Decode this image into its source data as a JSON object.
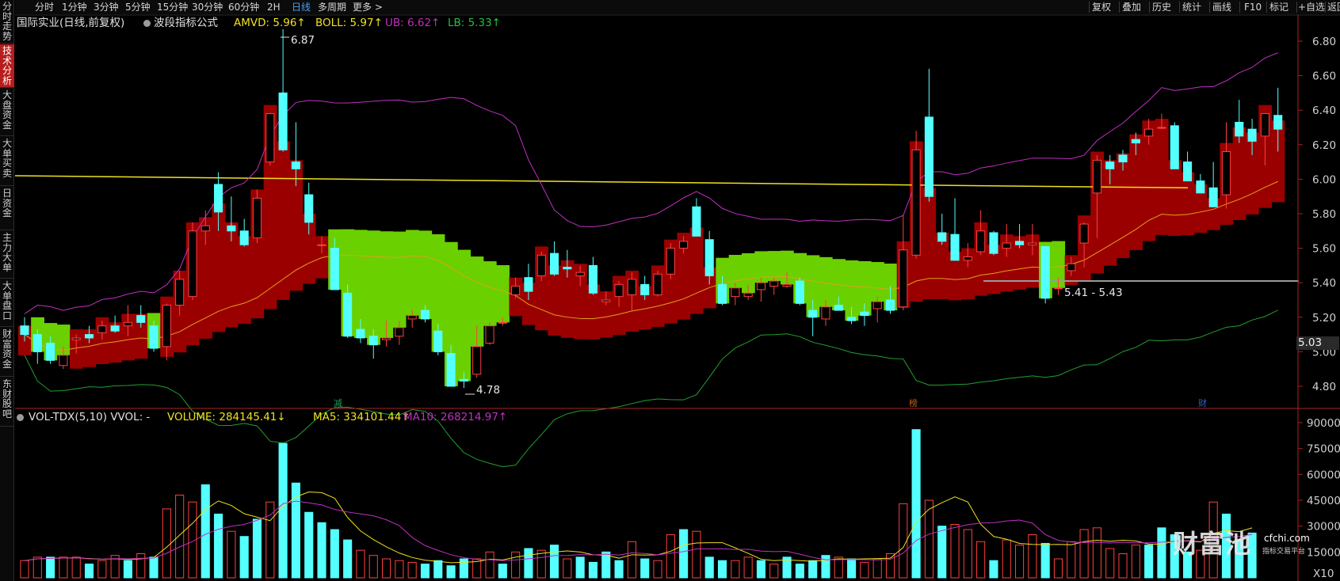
{
  "sidebar": {
    "tabs": [
      {
        "label": "分时走势",
        "active": false
      },
      {
        "label": "技术分析",
        "active": true
      },
      {
        "label": "大盘资金",
        "active": false
      },
      {
        "label": "大单买卖",
        "active": false
      },
      {
        "label": "日资金",
        "active": false
      },
      {
        "label": "主力大单",
        "active": false
      },
      {
        "label": "大单盘口",
        "active": false
      },
      {
        "label": "财富资金",
        "active": false
      },
      {
        "label": "东财股吧",
        "active": false
      }
    ]
  },
  "toolbar": {
    "periods": [
      "分时",
      "1分钟",
      "3分钟",
      "5分钟",
      "15分钟",
      "30分钟",
      "60分钟",
      "2H",
      "日线",
      "多周期",
      "更多 >"
    ],
    "active_period": "日线",
    "right_items": [
      "复权",
      "叠加",
      "历史",
      "统计",
      "画线",
      "F10",
      "标记",
      "+自选",
      "返回"
    ]
  },
  "legend": {
    "title": "国际实业(日线,前复权)",
    "formula": "波段指标公式",
    "amvd": "AMVD: 5.96↑",
    "boll": "BOLL: 5.97↑",
    "ub": "UB: 6.62↑",
    "lb": "LB: 5.33↑"
  },
  "volume_legend": {
    "title": "VOL-TDX(5,10) VVOL: -",
    "volume": "VOLUME: 284145.41↓",
    "ma5": "MA5: 334101.44↑",
    "ma10": "MA10: 268214.97↑"
  },
  "price_axis": {
    "labels": [
      "6.80",
      "6.60",
      "6.40",
      "6.20",
      "6.00",
      "5.80",
      "5.60",
      "5.40",
      "5.20",
      "5.00",
      "4.80"
    ],
    "current": "5.03"
  },
  "volume_axis": {
    "labels": [
      "90000",
      "75000",
      "60000",
      "45000",
      "30000",
      "15000"
    ],
    "unit": "X10"
  },
  "annotations": {
    "high": "6.87",
    "low": "4.78",
    "range": "5.41 - 5.43"
  },
  "events": [
    {
      "label": "减",
      "color": "#1fa05a"
    },
    {
      "label": "榜",
      "color": "#c06020"
    },
    {
      "label": "财",
      "color": "#3060c0"
    }
  ],
  "colors": {
    "up": "#ff4040",
    "down": "#54ffff",
    "ma_yellow": "#f0e020",
    "ub": "#c030c0",
    "lb": "#20a030",
    "fill_red": "#9b0000",
    "fill_green": "#6ad000",
    "axis": "#aa2222"
  },
  "watermark": {
    "brand": "财富池",
    "site": "cfchi.com",
    "sub": "指标交易平台"
  },
  "chart_data": {
    "type": "candlestick",
    "price_ylim": [
      4.7,
      6.9
    ],
    "volume_ylim": [
      0,
      90000
    ],
    "candles": [
      [
        5.15,
        5.2,
        5.06,
        5.1
      ],
      [
        5.1,
        5.13,
        4.93,
        5.0
      ],
      [
        5.05,
        5.09,
        4.93,
        4.95
      ],
      [
        4.92,
        5.03,
        4.9,
        4.98
      ],
      [
        5.07,
        5.1,
        4.99,
        5.08
      ],
      [
        5.1,
        5.15,
        5.05,
        5.08
      ],
      [
        5.11,
        5.18,
        5.07,
        5.15
      ],
      [
        5.15,
        5.21,
        5.11,
        5.12
      ],
      [
        5.15,
        5.27,
        5.09,
        5.17
      ],
      [
        5.21,
        5.27,
        5.14,
        5.17
      ],
      [
        5.15,
        5.18,
        5.0,
        5.02
      ],
      [
        5.03,
        5.28,
        4.95,
        5.27
      ],
      [
        5.27,
        5.47,
        5.21,
        5.42
      ],
      [
        5.32,
        5.75,
        5.3,
        5.7
      ],
      [
        5.7,
        5.82,
        5.62,
        5.73
      ],
      [
        5.97,
        6.04,
        5.7,
        5.81
      ],
      [
        5.73,
        5.9,
        5.64,
        5.7
      ],
      [
        5.7,
        5.77,
        5.61,
        5.62
      ],
      [
        5.66,
        5.94,
        5.63,
        5.89
      ],
      [
        6.1,
        6.27,
        6.08,
        6.38
      ],
      [
        6.5,
        6.87,
        6.16,
        6.17
      ],
      [
        6.1,
        6.33,
        5.96,
        6.06
      ],
      [
        5.91,
        5.98,
        5.68,
        5.75
      ],
      [
        5.62,
        5.67,
        5.57,
        5.62
      ],
      [
        5.6,
        5.66,
        5.39,
        5.36
      ],
      [
        5.34,
        5.39,
        5.08,
        5.09
      ],
      [
        5.13,
        5.19,
        5.05,
        5.08
      ],
      [
        5.09,
        5.13,
        4.96,
        5.04
      ],
      [
        5.07,
        5.18,
        5.03,
        5.08
      ],
      [
        5.09,
        5.18,
        5.04,
        5.14
      ],
      [
        5.19,
        5.24,
        5.14,
        5.21
      ],
      [
        5.24,
        5.27,
        5.17,
        5.19
      ],
      [
        5.12,
        5.16,
        4.98,
        5.0
      ],
      [
        4.99,
        5.04,
        4.8,
        4.8
      ],
      [
        4.84,
        4.88,
        4.79,
        4.83
      ],
      [
        4.87,
        5.15,
        4.85,
        5.03
      ],
      [
        5.05,
        5.17,
        5.04,
        5.15
      ],
      [
        5.17,
        5.2,
        5.15,
        5.17
      ],
      [
        5.33,
        5.43,
        5.31,
        5.38
      ],
      [
        5.43,
        5.51,
        5.3,
        5.35
      ],
      [
        5.44,
        5.58,
        5.41,
        5.56
      ],
      [
        5.57,
        5.64,
        5.44,
        5.45
      ],
      [
        5.49,
        5.59,
        5.43,
        5.48
      ],
      [
        5.44,
        5.5,
        5.38,
        5.46
      ],
      [
        5.5,
        5.55,
        5.33,
        5.34
      ],
      [
        5.29,
        5.35,
        5.27,
        5.3
      ],
      [
        5.32,
        5.41,
        5.26,
        5.39
      ],
      [
        5.33,
        5.46,
        5.24,
        5.42
      ],
      [
        5.39,
        5.44,
        5.3,
        5.33
      ],
      [
        5.33,
        5.47,
        5.32,
        5.45
      ],
      [
        5.45,
        5.63,
        5.42,
        5.6
      ],
      [
        5.6,
        5.67,
        5.57,
        5.64
      ],
      [
        5.84,
        5.89,
        5.68,
        5.67
      ],
      [
        5.65,
        5.7,
        5.39,
        5.44
      ],
      [
        5.39,
        5.44,
        5.27,
        5.28
      ],
      [
        5.32,
        5.4,
        5.27,
        5.37
      ],
      [
        5.32,
        5.39,
        5.3,
        5.34
      ],
      [
        5.36,
        5.43,
        5.29,
        5.4
      ],
      [
        5.38,
        5.43,
        5.33,
        5.41
      ],
      [
        5.38,
        5.46,
        5.37,
        5.39
      ],
      [
        5.41,
        5.43,
        5.27,
        5.28
      ],
      [
        5.24,
        5.3,
        5.09,
        5.2
      ],
      [
        5.19,
        5.3,
        5.15,
        5.26
      ],
      [
        5.27,
        5.32,
        5.24,
        5.24
      ],
      [
        5.2,
        5.26,
        5.16,
        5.18
      ],
      [
        5.23,
        5.28,
        5.15,
        5.21
      ],
      [
        5.25,
        5.32,
        5.17,
        5.29
      ],
      [
        5.3,
        5.38,
        5.22,
        5.24
      ],
      [
        5.26,
        5.79,
        5.24,
        5.59
      ],
      [
        5.56,
        6.28,
        5.54,
        6.17
      ],
      [
        6.36,
        6.64,
        5.87,
        5.9
      ],
      [
        5.69,
        5.8,
        5.62,
        5.64
      ],
      [
        5.68,
        5.89,
        5.6,
        5.53
      ],
      [
        5.53,
        5.63,
        5.49,
        5.55
      ],
      [
        5.58,
        5.82,
        5.56,
        5.7
      ],
      [
        5.69,
        5.7,
        5.56,
        5.57
      ],
      [
        5.6,
        5.74,
        5.55,
        5.63
      ],
      [
        5.64,
        5.74,
        5.6,
        5.62
      ],
      [
        5.62,
        5.74,
        5.56,
        5.63
      ],
      [
        5.61,
        5.58,
        5.28,
        5.31
      ],
      [
        5.37,
        5.43,
        5.33,
        5.37
      ],
      [
        5.47,
        5.55,
        5.44,
        5.51
      ],
      [
        5.63,
        5.75,
        5.49,
        5.74
      ],
      [
        5.92,
        6.14,
        5.66,
        6.11
      ],
      [
        6.1,
        6.14,
        5.97,
        6.06
      ],
      [
        6.14,
        6.17,
        6.05,
        6.1
      ],
      [
        6.23,
        6.27,
        6.14,
        6.21
      ],
      [
        6.25,
        6.35,
        6.2,
        6.29
      ],
      [
        6.3,
        6.38,
        6.29,
        6.3
      ],
      [
        6.31,
        6.33,
        6.11,
        6.06
      ],
      [
        6.1,
        6.16,
        5.99,
        5.99
      ],
      [
        5.99,
        6.03,
        5.92,
        5.92
      ],
      [
        5.95,
        6.1,
        5.89,
        5.84
      ],
      [
        5.91,
        6.33,
        5.83,
        6.16
      ],
      [
        6.33,
        6.46,
        6.21,
        6.25
      ],
      [
        6.29,
        6.35,
        6.14,
        6.22
      ],
      [
        6.25,
        6.38,
        6.08,
        6.38
      ],
      [
        6.37,
        6.53,
        6.16,
        6.29
      ]
    ],
    "volume": [
      [
        10,
        "u"
      ],
      [
        12,
        "u"
      ],
      [
        12,
        "d"
      ],
      [
        12,
        "u"
      ],
      [
        12,
        "u"
      ],
      [
        8,
        "d"
      ],
      [
        10,
        "u"
      ],
      [
        13,
        "u"
      ],
      [
        10,
        "d"
      ],
      [
        14,
        "u"
      ],
      [
        12,
        "d"
      ],
      [
        40,
        "u"
      ],
      [
        48,
        "u"
      ],
      [
        44,
        "u"
      ],
      [
        54,
        "d"
      ],
      [
        37,
        "d"
      ],
      [
        27,
        "u"
      ],
      [
        24,
        "d"
      ],
      [
        34,
        "d"
      ],
      [
        44,
        "u"
      ],
      [
        78,
        "d"
      ],
      [
        55,
        "d"
      ],
      [
        38,
        "d"
      ],
      [
        32,
        "d"
      ],
      [
        28,
        "d"
      ],
      [
        22,
        "d"
      ],
      [
        16,
        "u"
      ],
      [
        13,
        "u"
      ],
      [
        11,
        "u"
      ],
      [
        10,
        "u"
      ],
      [
        9,
        "u"
      ],
      [
        8,
        "d"
      ],
      [
        10,
        "d"
      ],
      [
        7,
        "d"
      ],
      [
        11,
        "d"
      ],
      [
        11,
        "u"
      ],
      [
        15,
        "u"
      ],
      [
        8,
        "d"
      ],
      [
        15,
        "u"
      ],
      [
        17,
        "d"
      ],
      [
        16,
        "u"
      ],
      [
        19,
        "d"
      ],
      [
        11,
        "u"
      ],
      [
        12,
        "d"
      ],
      [
        9,
        "d"
      ],
      [
        15,
        "d"
      ],
      [
        10,
        "d"
      ],
      [
        21,
        "u"
      ],
      [
        11,
        "d"
      ],
      [
        10,
        "u"
      ],
      [
        25,
        "u"
      ],
      [
        28,
        "d"
      ],
      [
        27,
        "u"
      ],
      [
        12,
        "d"
      ],
      [
        10,
        "d"
      ],
      [
        10,
        "u"
      ],
      [
        12,
        "u"
      ],
      [
        10,
        "d"
      ],
      [
        8,
        "u"
      ],
      [
        12,
        "d"
      ],
      [
        8,
        "d"
      ],
      [
        10,
        "d"
      ],
      [
        13,
        "d"
      ],
      [
        12,
        "u"
      ],
      [
        11,
        "d"
      ],
      [
        9,
        "u"
      ],
      [
        11,
        "u"
      ],
      [
        14,
        "u"
      ],
      [
        43,
        "u"
      ],
      [
        86,
        "d"
      ],
      [
        45,
        "u"
      ],
      [
        30,
        "d"
      ],
      [
        31,
        "u"
      ],
      [
        28,
        "u"
      ],
      [
        21,
        "u"
      ],
      [
        10,
        "d"
      ],
      [
        22,
        "u"
      ],
      [
        19,
        "u"
      ],
      [
        25,
        "u"
      ],
      [
        20,
        "d"
      ],
      [
        11,
        "u"
      ],
      [
        21,
        "u"
      ],
      [
        28,
        "u"
      ],
      [
        29,
        "u"
      ],
      [
        17,
        "u"
      ],
      [
        14,
        "u"
      ],
      [
        19,
        "u"
      ],
      [
        19,
        "d"
      ],
      [
        29,
        "d"
      ],
      [
        25,
        "d"
      ],
      [
        15,
        "d"
      ],
      [
        16,
        "u"
      ],
      [
        44,
        "u"
      ],
      [
        37,
        "d"
      ],
      [
        22,
        "d"
      ],
      [
        26,
        "d"
      ]
    ]
  }
}
